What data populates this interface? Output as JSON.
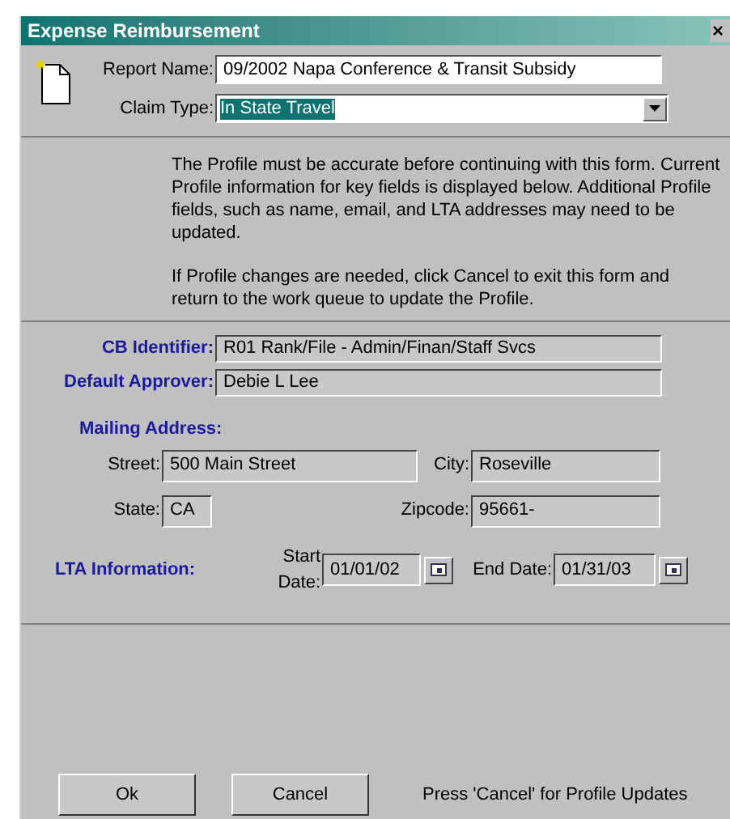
{
  "window": {
    "title": "Expense Reimbursement",
    "close": "×"
  },
  "report_name": {
    "label": "Report Name:",
    "value": "09/2002 Napa Conference & Transit Subsidy"
  },
  "claim_type": {
    "label": "Claim Type:",
    "value": "In State Travel",
    "selected": true
  },
  "message": [
    "The Profile must be accurate before continuing with this form.  Current Profile information for key fields is displayed below.  Additional Profile fields, such as name, email, and LTA addresses may need to be updated.",
    "If Profile changes are needed, click Cancel to exit this form and return to the work queue to update the Profile."
  ],
  "profile": [
    {
      "label": "CB Identifier:",
      "value": "R01 Rank/File - Admin/Finan/Staff Svcs"
    },
    {
      "label": "Default Approver:",
      "value": "Debie L Lee"
    }
  ],
  "mailing": {
    "heading": "Mailing Address:",
    "street": {
      "label": "Street:",
      "value": "500 Main Street"
    },
    "city": {
      "label": "City:",
      "value": "Roseville"
    },
    "state": {
      "label": "State:",
      "value": "CA"
    },
    "zipcode": {
      "label": "Zipcode:",
      "value": "95661-"
    }
  },
  "lta": {
    "heading": "LTA Information:",
    "start": {
      "label": "Start Date:",
      "value": "01/01/02"
    },
    "end": {
      "label": "End Date:",
      "value": "01/31/03"
    }
  },
  "buttons": [
    "Ok",
    "Cancel"
  ],
  "hint": "Press 'Cancel' for Profile Updates"
}
